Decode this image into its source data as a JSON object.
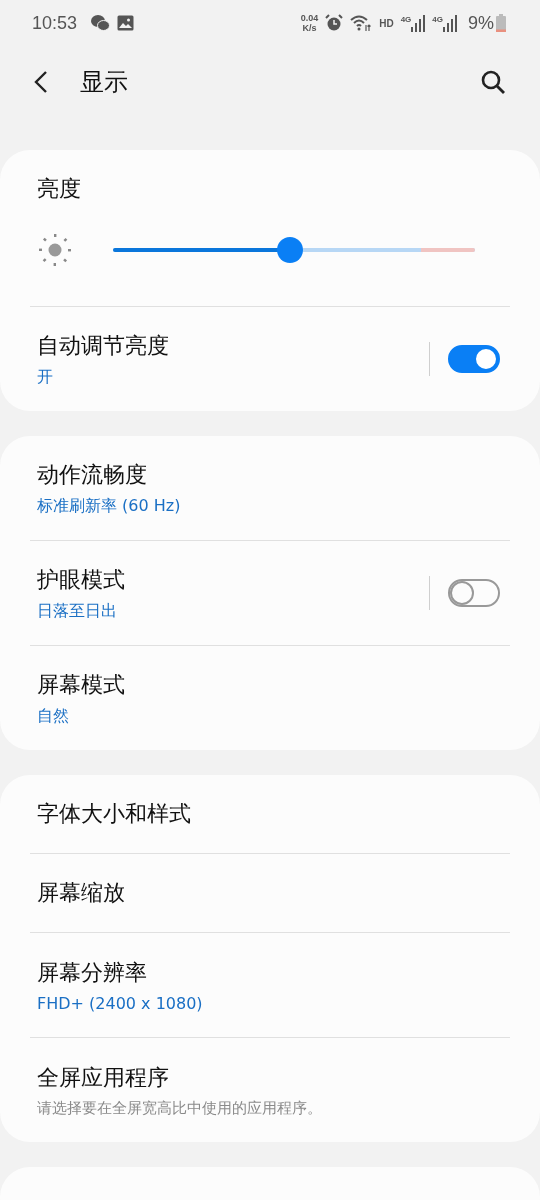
{
  "status_bar": {
    "time": "10:53",
    "net_speed_value": "0.04",
    "net_speed_unit": "K/s",
    "hd_label": "HD",
    "sim_labels": [
      "4G",
      "4G"
    ],
    "battery": "9%"
  },
  "header": {
    "title": "显示"
  },
  "sections": [
    {
      "items": [
        {
          "kind": "slider",
          "label": "亮度",
          "level": 0.49
        },
        {
          "kind": "switch",
          "label": "自动调节亮度",
          "summary": "开",
          "on": true
        }
      ]
    },
    {
      "items": [
        {
          "kind": "item",
          "label": "动作流畅度",
          "summary": "标准刷新率 (60 Hz)"
        },
        {
          "kind": "switch",
          "label": "护眼模式",
          "summary": "日落至日出",
          "on": false
        },
        {
          "kind": "item",
          "label": "屏幕模式",
          "summary": "自然"
        }
      ]
    },
    {
      "items": [
        {
          "kind": "item",
          "label": "字体大小和样式"
        },
        {
          "kind": "item",
          "label": "屏幕缩放"
        },
        {
          "kind": "item",
          "label": "屏幕分辨率",
          "summary": "FHD+ (2400 x 1080)"
        },
        {
          "kind": "item",
          "label": "全屏应用程序",
          "description": "请选择要在全屏宽高比中使用的应用程序。"
        }
      ]
    }
  ]
}
